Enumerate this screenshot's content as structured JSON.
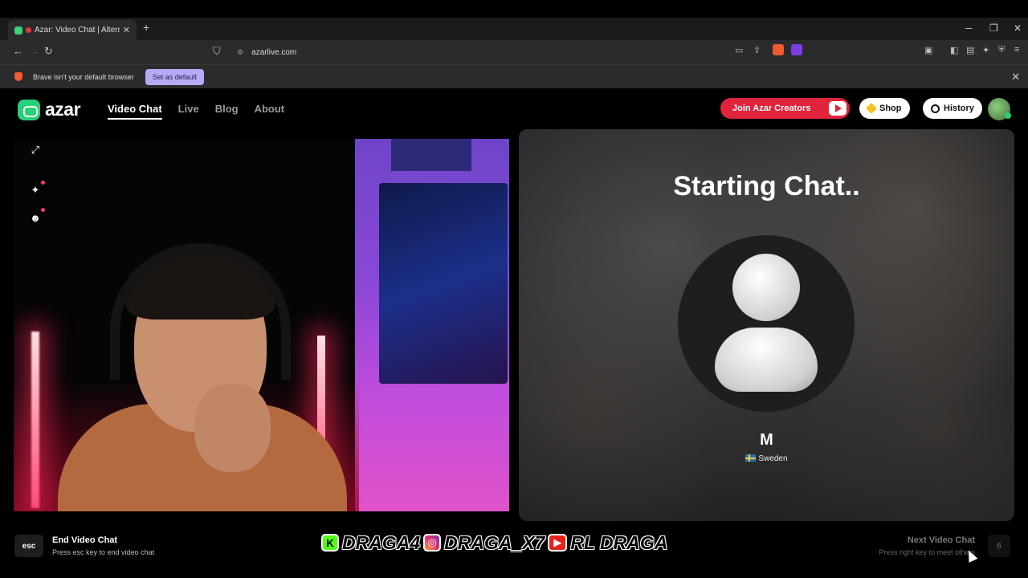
{
  "browser": {
    "tab_title": "Azar: Video Chat | Alternative",
    "url": "azarlive.com",
    "infobar_message": "Brave isn't your default browser",
    "set_default_label": "Set as default"
  },
  "site": {
    "logo_text": "azar",
    "nav": [
      {
        "label": "Video Chat",
        "active": true
      },
      {
        "label": "Live",
        "active": false
      },
      {
        "label": "Blog",
        "active": false
      },
      {
        "label": "About",
        "active": false
      }
    ],
    "creators_label": "Join Azar Creators",
    "shop_label": "Shop",
    "history_label": "History"
  },
  "chat": {
    "status": "Starting Chat..",
    "peer_name": "M",
    "peer_country": "Sweden"
  },
  "footer": {
    "esc_key": "esc",
    "end_title": "End Video Chat",
    "end_hint": "Press esc key to end video chat",
    "next_title": "Next Video Chat",
    "next_hint": "Press right key to meet others",
    "next_key": "6"
  },
  "overlay": {
    "kick": "DRAGA4",
    "instagram": "DRAGA_X7",
    "youtube": "RL DRAGA"
  },
  "colors": {
    "brand_green": "#28d07a",
    "creators_red": "#e0243c",
    "set_default_bg": "#b6a9f5"
  }
}
